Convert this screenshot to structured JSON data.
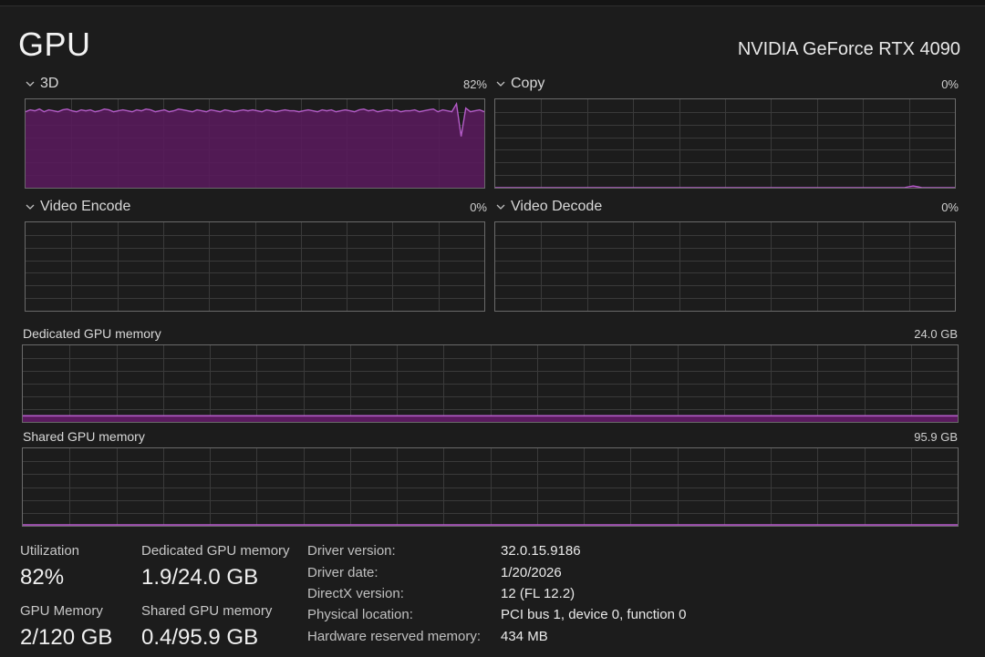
{
  "header": {
    "title": "GPU",
    "device_name": "NVIDIA GeForce RTX 4090"
  },
  "engines": [
    {
      "label": "3D",
      "percent_label": "82%",
      "utilization": 82
    },
    {
      "label": "Copy",
      "percent_label": "0%",
      "utilization": 0
    },
    {
      "label": "Video Encode",
      "percent_label": "0%",
      "utilization": 0
    },
    {
      "label": "Video Decode",
      "percent_label": "0%",
      "utilization": 0
    }
  ],
  "memory_graphs": {
    "dedicated": {
      "label": "Dedicated GPU memory",
      "capacity_label": "24.0 GB",
      "used_gb": 1.9,
      "capacity_gb": 24.0
    },
    "shared": {
      "label": "Shared GPU memory",
      "capacity_label": "95.9 GB",
      "used_gb": 0.4,
      "capacity_gb": 95.9
    }
  },
  "stats": {
    "utilization_label": "Utilization",
    "utilization_value": "82%",
    "dedicated_label": "Dedicated GPU memory",
    "dedicated_value": "1.9/24.0 GB",
    "gpu_memory_label": "GPU Memory",
    "gpu_memory_value": "2/120 GB",
    "shared_label": "Shared GPU memory",
    "shared_value": "0.4/95.9 GB"
  },
  "info": {
    "driver_version_label": "Driver version:",
    "driver_version_value": "32.0.15.9186",
    "driver_date_label": "Driver date:",
    "driver_date_value": "1/20/2026",
    "directx_label": "DirectX version:",
    "directx_value": "12 (FL 12.2)",
    "location_label": "Physical location:",
    "location_value": "PCI bus 1, device 0, function 0",
    "reserved_label": "Hardware reserved memory:",
    "reserved_value": "434 MB"
  },
  "colors": {
    "accent_line": "#b45cc8",
    "accent_fill": "#5a1a5e",
    "grid": "#3a3a3a",
    "border": "#6a6a6a"
  },
  "chart_data": [
    {
      "type": "area",
      "title": "3D",
      "ylim": [
        0,
        100
      ],
      "values": [
        86,
        88,
        87,
        89,
        86,
        88,
        87,
        86,
        88,
        89,
        87,
        86,
        88,
        87,
        88,
        86,
        87,
        89,
        88,
        86,
        87,
        88,
        87,
        86,
        88,
        87,
        89,
        88,
        86,
        87,
        88,
        86,
        87,
        89,
        88,
        87,
        86,
        88,
        87,
        86,
        88,
        87,
        86,
        88,
        87,
        86,
        87,
        88,
        87,
        88,
        87,
        86,
        88,
        87,
        86,
        87,
        88,
        87,
        87,
        86,
        87,
        88,
        87,
        86,
        88,
        87,
        88,
        86,
        87,
        88,
        87,
        86,
        88,
        89,
        87,
        88,
        86,
        87,
        88,
        87,
        88,
        86,
        87,
        87,
        88,
        86,
        87,
        88,
        89,
        86,
        88,
        87,
        86,
        95,
        58,
        90,
        86,
        87,
        88,
        86
      ]
    },
    {
      "type": "area",
      "title": "Copy",
      "ylim": [
        0,
        100
      ],
      "values": [
        0,
        0,
        0,
        0,
        0,
        0,
        0,
        0,
        0,
        0,
        0,
        0,
        0,
        0,
        0,
        0,
        0,
        0,
        0,
        0,
        0,
        0,
        0,
        0,
        0,
        0,
        0,
        0,
        0,
        0,
        0,
        0,
        0,
        0,
        0,
        0,
        0,
        0,
        0,
        0,
        0,
        0,
        0,
        0,
        0,
        0,
        0,
        0,
        0,
        0,
        0,
        0,
        0,
        0,
        0,
        0,
        0,
        0,
        0,
        0,
        0,
        0,
        0,
        0,
        0,
        0,
        0,
        0,
        0,
        0,
        0,
        0,
        0,
        0,
        0,
        0,
        0,
        0,
        0,
        0,
        0,
        0,
        0,
        0,
        0,
        0,
        0,
        0,
        0,
        1,
        2,
        1,
        0,
        0,
        0,
        0,
        0,
        0,
        0,
        0
      ]
    },
    {
      "type": "area",
      "title": "Video Encode",
      "ylim": [
        0,
        100
      ],
      "values": [
        0,
        0
      ]
    },
    {
      "type": "area",
      "title": "Video Decode",
      "ylim": [
        0,
        100
      ],
      "values": [
        0,
        0
      ]
    }
  ]
}
